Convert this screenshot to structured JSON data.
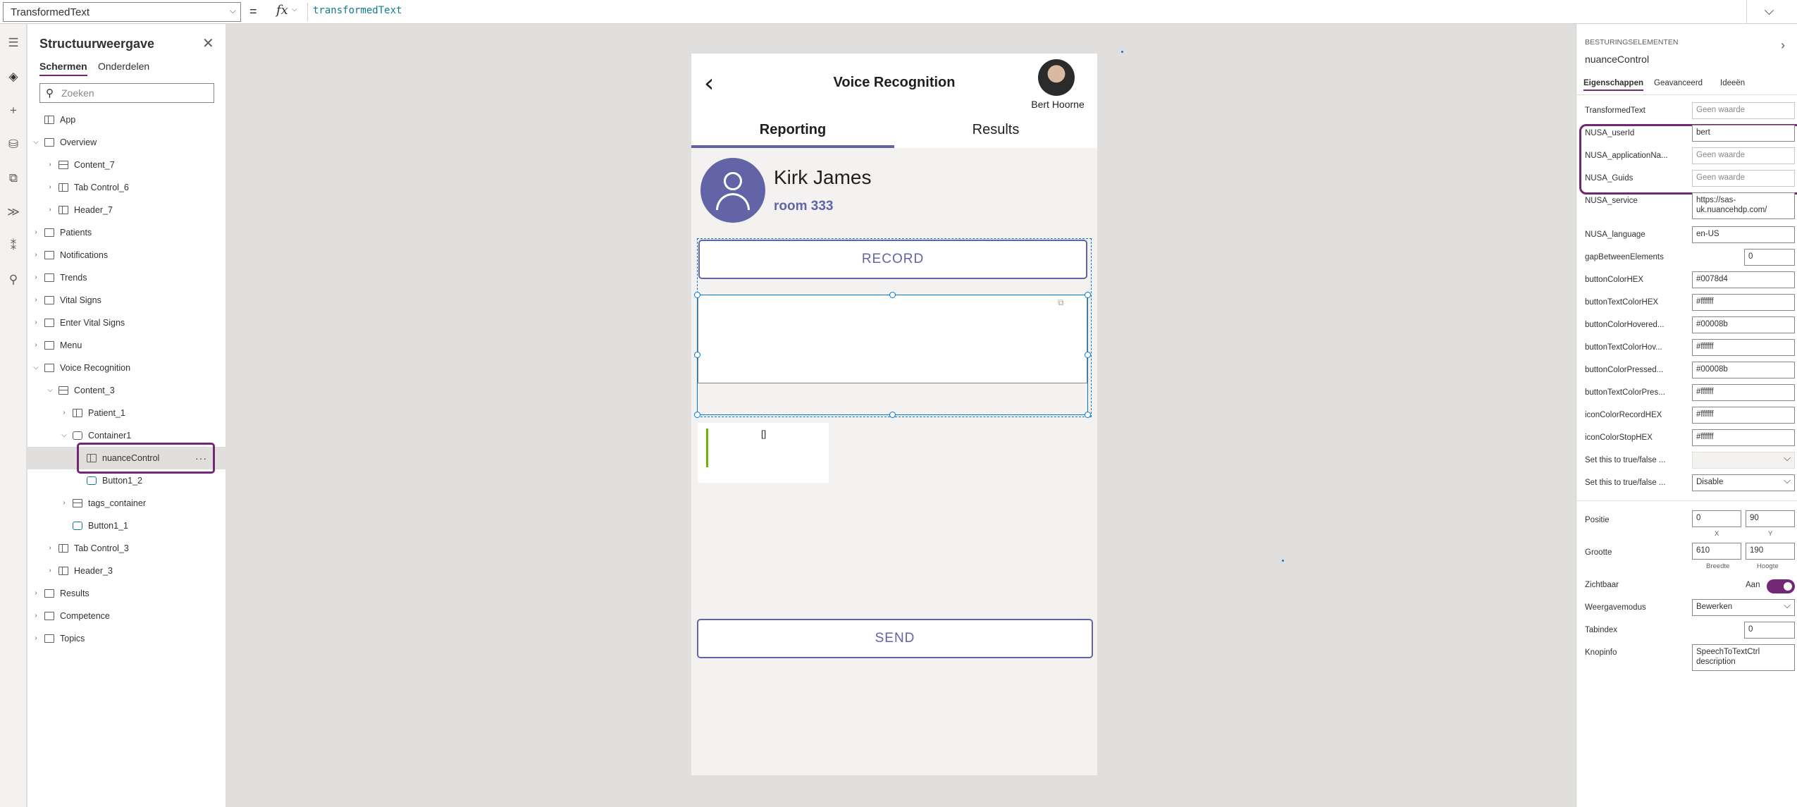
{
  "formula": {
    "property": "TransformedText",
    "equals": "=",
    "fx": "fx",
    "value": "transformedText"
  },
  "tree": {
    "title": "Structuurweergave",
    "tabs": [
      "Schermen",
      "Onderdelen"
    ],
    "search_placeholder": "Zoeken",
    "items": [
      {
        "label": "App"
      },
      {
        "label": "Overview"
      },
      {
        "label": "Content_7"
      },
      {
        "label": "Tab Control_6"
      },
      {
        "label": "Header_7"
      },
      {
        "label": "Patients"
      },
      {
        "label": "Notifications"
      },
      {
        "label": "Trends"
      },
      {
        "label": "Vital Signs"
      },
      {
        "label": "Enter Vital Signs"
      },
      {
        "label": "Menu"
      },
      {
        "label": "Voice Recognition"
      },
      {
        "label": "Content_3"
      },
      {
        "label": "Patient_1"
      },
      {
        "label": "Container1"
      },
      {
        "label": "nuanceControl"
      },
      {
        "label": "Button1_2"
      },
      {
        "label": "tags_container"
      },
      {
        "label": "Button1_1"
      },
      {
        "label": "Tab Control_3"
      },
      {
        "label": "Header_3"
      },
      {
        "label": "Results"
      },
      {
        "label": "Competence"
      },
      {
        "label": "Topics"
      }
    ],
    "more": "···"
  },
  "phone": {
    "title": "Voice Recognition",
    "user_name": "Bert Hoorne",
    "tabs": [
      "Reporting",
      "Results"
    ],
    "patient_name": "Kirk James",
    "room": "room 333",
    "record_label": "RECORD",
    "tag_value": "[]",
    "send_label": "SEND"
  },
  "props": {
    "kicker": "BESTURINGSELEMENTEN",
    "control_name": "nuanceControl",
    "tabs": [
      "Eigenschappen",
      "Geavanceerd",
      "Ideeën"
    ],
    "rows": [
      {
        "label": "TransformedText",
        "value": "Geen waarde"
      },
      {
        "label": "NUSA_userId",
        "value": "bert"
      },
      {
        "label": "NUSA_applicationNa...",
        "value": "Geen waarde"
      },
      {
        "label": "NUSA_Guids",
        "value": "Geen waarde"
      },
      {
        "label": "NUSA_service",
        "value": "https://sas-uk.nuancehdp.com/"
      },
      {
        "label": "NUSA_language",
        "value": "en-US"
      },
      {
        "label": "gapBetweenElements",
        "value": "0"
      },
      {
        "label": "buttonColorHEX",
        "value": "#0078d4"
      },
      {
        "label": "buttonTextColorHEX",
        "value": "#ffffff"
      },
      {
        "label": "buttonColorHovered...",
        "value": "#00008b"
      },
      {
        "label": "buttonTextColorHov...",
        "value": "#ffffff"
      },
      {
        "label": "buttonColorPressed...",
        "value": "#00008b"
      },
      {
        "label": "buttonTextColorPres...",
        "value": "#ffffff"
      },
      {
        "label": "iconColorRecordHEX",
        "value": "#ffffff"
      },
      {
        "label": "iconColorStopHEX",
        "value": "#ffffff"
      },
      {
        "label": "Set this to true/false ...",
        "value": ""
      },
      {
        "label": "Set this to true/false ...",
        "value": "Disable"
      }
    ],
    "position": {
      "label": "Positie",
      "x": "0",
      "y": "90",
      "x_label": "X",
      "y_label": "Y"
    },
    "size": {
      "label": "Grootte",
      "w": "610",
      "h": "190",
      "w_label": "Breedte",
      "h_label": "Hoogte"
    },
    "visible": {
      "label": "Zichtbaar",
      "state": "Aan"
    },
    "display_mode": {
      "label": "Weergavemodus",
      "value": "Bewerken"
    },
    "tabindex": {
      "label": "Tabindex",
      "value": "0"
    },
    "tooltip": {
      "label": "Knopinfo",
      "value": "SpeechToTextCtrl description"
    }
  },
  "colors": {
    "accent": "#742774",
    "brand": "#6264a7",
    "selection": "#0078d4"
  }
}
